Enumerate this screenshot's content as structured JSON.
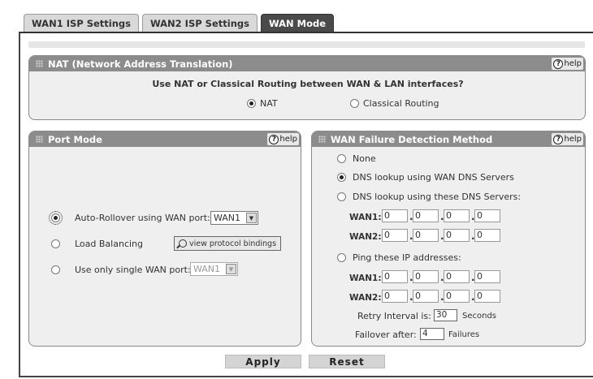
{
  "tabs": [
    "WAN1 ISP Settings",
    "WAN2 ISP Settings",
    "WAN Mode"
  ],
  "nat": {
    "title": "NAT (Network Address Translation)",
    "help": "help",
    "question": "Use NAT or Classical Routing between WAN & LAN interfaces?",
    "options": [
      "NAT",
      "Classical Routing"
    ],
    "selected": "NAT"
  },
  "port_mode": {
    "title": "Port Mode",
    "help": "help",
    "auto_rollover": "Auto-Rollover using WAN port:",
    "auto_rollover_value": "WAN1",
    "load_balancing": "Load Balancing",
    "view_bindings": "view protocol bindings",
    "single_port": "Use only single WAN port:",
    "single_port_value": "WAN1",
    "selected": "Auto-Rollover"
  },
  "failure": {
    "title": "WAN Failure Detection Method",
    "help": "help",
    "none": "None",
    "dns_wan": "DNS lookup using WAN DNS Servers",
    "dns_these": "DNS lookup using these DNS Servers:",
    "ping": "Ping these IP addresses:",
    "wan1_label": "WAN1:",
    "wan2_label": "WAN2:",
    "octet": "0",
    "retry_label": "Retry Interval is:",
    "retry_value": "30",
    "retry_unit": "Seconds",
    "failover_label": "Failover after:",
    "failover_value": "4",
    "failover_unit": "Failures",
    "selected": "DNS lookup using WAN DNS Servers"
  },
  "actions": {
    "apply": "Apply",
    "reset": "Reset"
  }
}
